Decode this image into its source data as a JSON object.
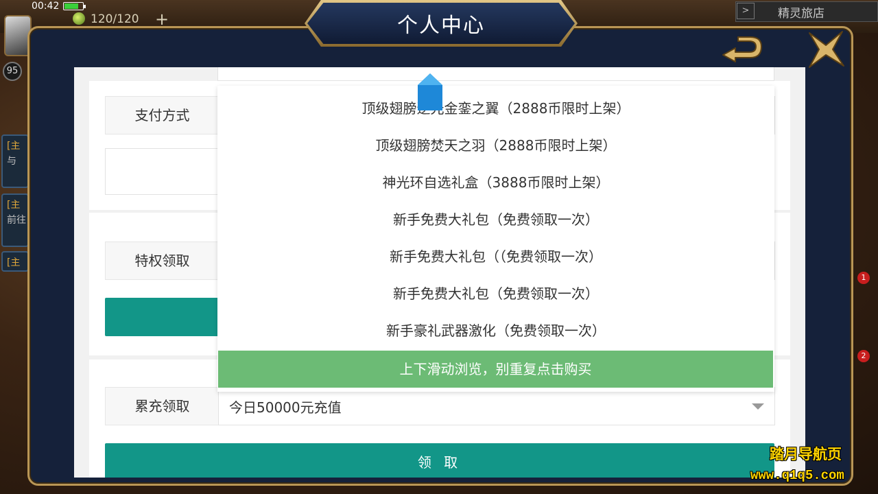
{
  "status_bar": {
    "time": "00:42"
  },
  "game_hud": {
    "energy": "120/120",
    "plus_glyph": "+",
    "level": "95",
    "inn_label": "精灵旅店",
    "inn_arrow_glyph": ">",
    "quest_tag": "[主",
    "quest_subs": [
      "与",
      "前往"
    ],
    "right_badges": [
      "1",
      "2"
    ]
  },
  "modal": {
    "title": "个人中心",
    "back_icon": "back-arrow-icon",
    "close_icon": "close-x-icon"
  },
  "form": {
    "payment_label": "支付方式",
    "privilege_label": "特权领取",
    "cumulative_label": "累充领取",
    "cumulative_value": "今日50000元充值",
    "claim_button": "领 取"
  },
  "dropdown": {
    "items": [
      "顶级翅膀逆光金銮之翼（2888币限时上架）",
      "顶级翅膀焚天之羽（2888币限时上架）",
      "神光环自选礼盒（3888币限时上架）",
      "新手免费大礼包（免费领取一次）",
      "新手免费大礼包（（免费领取一次）",
      "新手免费大礼包（免费领取一次）",
      "新手豪礼武器激化（免费领取一次）"
    ],
    "selected": "上下滑动浏览，别重复点击购买"
  },
  "watermark": {
    "name": "踏月导航页",
    "url": "www.q1q5.com"
  },
  "colors": {
    "teal": "#129688",
    "selected_green": "#6cbb75",
    "frame_gold": "#b99655",
    "frame_navy": "#15213a"
  }
}
